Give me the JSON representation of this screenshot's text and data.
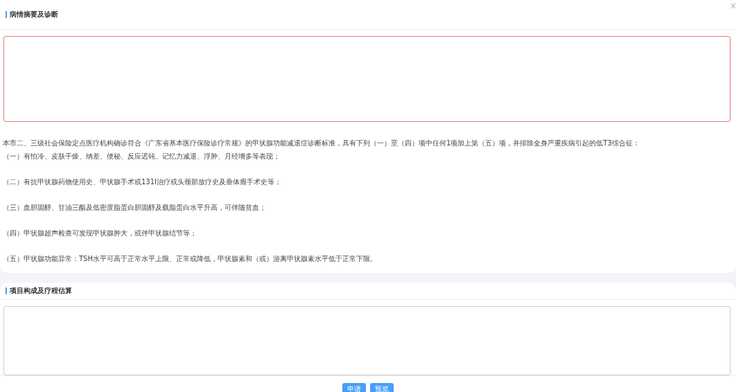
{
  "sections": [
    {
      "title": "病情摘要及诊断",
      "textarea": {
        "invalid": true
      },
      "intro": "本市二、三级社会保险定点医疗机构确诊符合《广东省基本医疗保险诊疗常规》的甲状腺功能减退症诊断标准，具有下列（一）至（四）项中任何1项加上第（五）项，并排除全身严重疾病引起的低T3综合征：",
      "items": [
        "（一）有怕冷、皮肤干燥、纳差、便秘、反应迟钝、记忆力减退、浮肿、月经增多等表现；",
        "（二）有抗甲状腺药物使用史、甲状腺手术或131I治疗或头颈部放疗史及垂体瘤手术史等；",
        "（三）血胆固醇、甘油三酯及低密度脂蛋白胆固醇及载脂蛋白水平升高，可伴随贫血；",
        "（四）甲状腺超声检查可发现甲状腺肿大，或伴甲状腺结节等；",
        "（五）甲状腺功能异常：TSH水平可高于正常水平上限、正常或降低，甲状腺素和（或）游离甲状腺素水平低于正常下限。"
      ]
    },
    {
      "title": "项目构成及疗程估算",
      "textarea": {
        "invalid": false
      }
    }
  ],
  "buttons": [
    "申请",
    "预览"
  ]
}
